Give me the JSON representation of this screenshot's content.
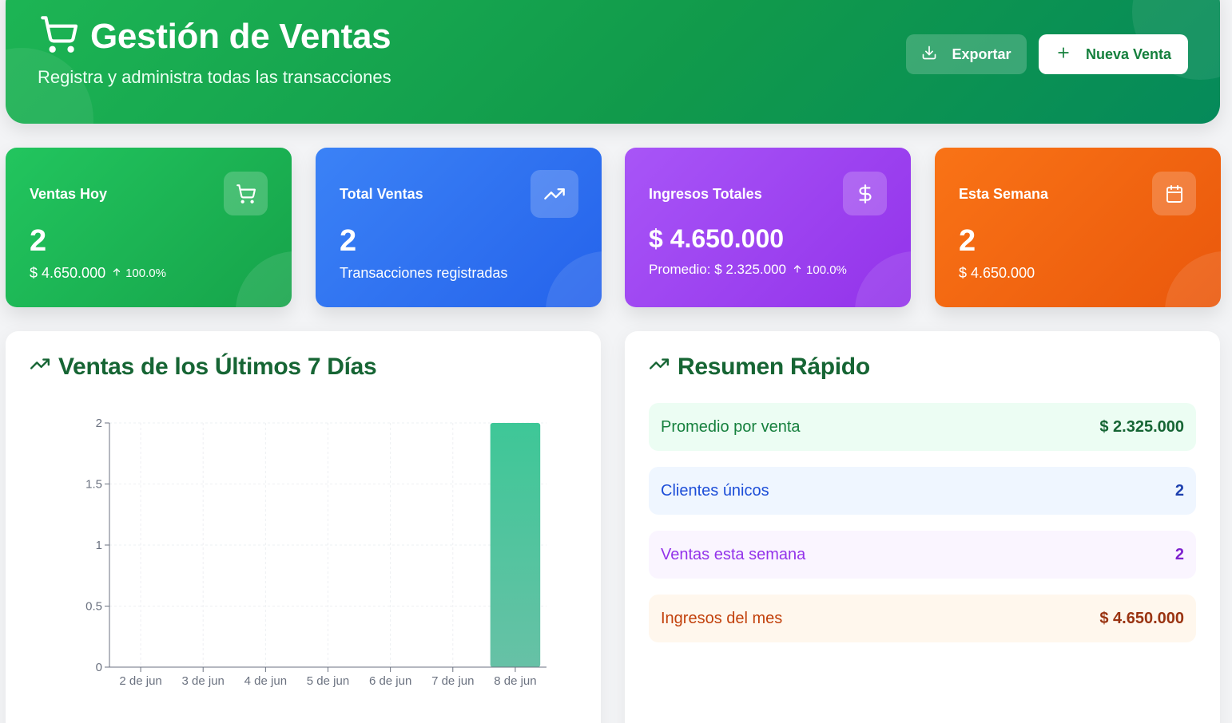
{
  "header": {
    "title": "Gestión de Ventas",
    "subtitle": "Registra y administra todas las transacciones",
    "export_label": "Exportar",
    "new_sale_label": "Nueva Venta"
  },
  "stats": [
    {
      "label": "Ventas Hoy",
      "value": "2",
      "sub": "$ 4.650.000",
      "trend": "100.0%",
      "icon": "cart-icon"
    },
    {
      "label": "Total Ventas",
      "value": "2",
      "sub": "Transacciones registradas",
      "icon": "trending-up-icon"
    },
    {
      "label": "Ingresos Totales",
      "value": "$ 4.650.000",
      "sub": "Promedio: $ 2.325.000",
      "trend": "100.0%",
      "icon": "dollar-icon"
    },
    {
      "label": "Esta Semana",
      "value": "2",
      "sub": "$ 4.650.000",
      "icon": "calendar-icon"
    }
  ],
  "chart_panel": {
    "title": "Ventas de los Últimos 7 Días"
  },
  "chart_data": {
    "type": "bar",
    "title": "Ventas de los Últimos 7 Días",
    "categories": [
      "2 de jun",
      "3 de jun",
      "4 de jun",
      "5 de jun",
      "6 de jun",
      "7 de jun",
      "8 de jun"
    ],
    "values": [
      0,
      0,
      0,
      0,
      0,
      0,
      2
    ],
    "ylim": [
      0,
      2
    ],
    "yticks": [
      "0",
      "0.5",
      "1",
      "1.5",
      "2"
    ],
    "grid": true,
    "bar_color": "#34c796"
  },
  "summary": {
    "title": "Resumen Rápido",
    "rows": [
      {
        "label": "Promedio por venta",
        "value": "$ 2.325.000"
      },
      {
        "label": "Clientes únicos",
        "value": "2"
      },
      {
        "label": "Ventas esta semana",
        "value": "2"
      },
      {
        "label": "Ingresos del mes",
        "value": "$ 4.650.000"
      }
    ]
  },
  "colors": {
    "brand_green": "#16a34a",
    "blue": "#2563eb",
    "purple": "#9333ea",
    "orange": "#ea580c"
  }
}
